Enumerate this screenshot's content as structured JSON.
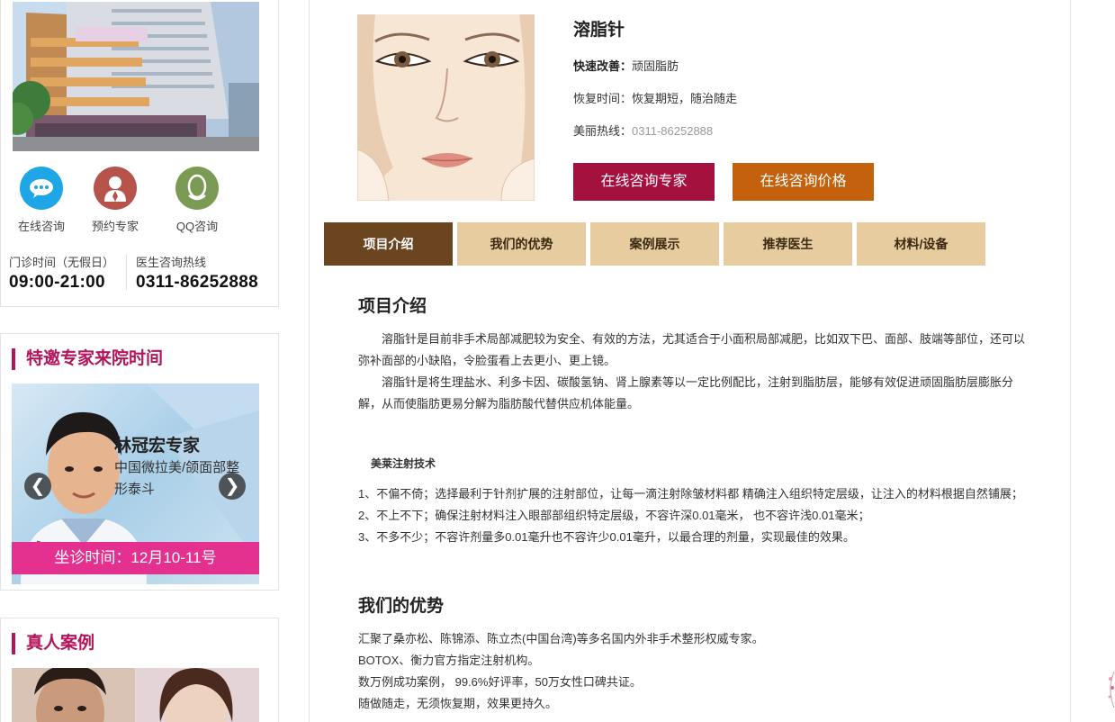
{
  "sidebar": {
    "quick_links": [
      {
        "label": "在线咨询",
        "icon": "chat-bubble-icon",
        "color": "#1ea6e6"
      },
      {
        "label": "预约专家",
        "icon": "doctor-icon",
        "color": "#b6534b"
      },
      {
        "label": "QQ咨询",
        "icon": "qq-penguin-icon",
        "color": "#7b9b55"
      }
    ],
    "hours_label": "门诊时间（无假日）",
    "hours_value": "09:00-21:00",
    "hotline_label": "医生咨询热线",
    "hotline_value": "0311-86252888",
    "expert_section": {
      "title": "特邀专家来院时间",
      "name": "林冠宏专家",
      "desc": "中国微拉美/颌面部整形泰斗",
      "prev": "❮",
      "next": "❯",
      "visit_time": "坐诊时间：12月10-11号"
    },
    "cases_section": {
      "title": "真人案例"
    }
  },
  "product": {
    "title": "溶脂针",
    "quick_label": "快速改善：",
    "quick_value": "顽固脂肪",
    "recovery": "恢复时间：恢复期短，随治随走",
    "hotline_label": "美丽热线：",
    "hotline_value": "0311-86252888",
    "btn_expert": "在线咨询专家",
    "btn_price": "在线咨询价格"
  },
  "tabs": [
    {
      "label": "项目介绍",
      "active": true
    },
    {
      "label": "我们的优势",
      "active": false
    },
    {
      "label": "案例展示",
      "active": false
    },
    {
      "label": "推荐医生",
      "active": false
    },
    {
      "label": "材料/设备",
      "active": false
    }
  ],
  "intro": {
    "heading": "项目介绍",
    "p1": "溶脂针是目前非手术局部减肥较为安全、有效的方法，尤其适合于小面积局部减肥，比如双下巴、面部、肢端等部位，还可以弥补面部的小缺陷，令脸蛋看上去更小、更上镜。",
    "p2": "溶脂针是将生理盐水、利多卡因、碳酸氢钠、肾上腺素等以一定比例配比，注射到脂肪层，能够有效促进顽固脂肪层膨胀分解，从而使脂肪更易分解为脂肪酸代替供应机体能量。"
  },
  "technique": {
    "heading": "美莱注射技术",
    "items": [
      "1、不偏不倚；选择最利于针剂扩展的注射部位，让每一滴注射除皱材料都 精确注入组织特定层级，让注入的材料根据自然铺展；",
      "2、不上不下；确保注射材料注入眼部部组织特定层级，不容许深0.01毫米， 也不容许浅0.01毫米；",
      "3、不多不少；不容许剂量多0.01毫升也不容许少0.01毫升，以最合理的剂量，实现最佳的效果。"
    ]
  },
  "advantages": {
    "heading": "我们的优势",
    "items": [
      "汇聚了桑亦松、陈锦添、陈立杰(中国台湾)等多名国内外非手术整形权威专家。",
      "BOTOX、衡力官方指定注射机构。",
      "数万例成功案例， 99.6%好评率，50万女性口碑共证。",
      "随做随走，无须恢复期，效果更持久。"
    ]
  },
  "colors": {
    "accent": "#b3155a",
    "tab_active": "#6b4520",
    "tab_inactive": "#e6cc9f",
    "btn_expert": "#a5113e",
    "btn_price": "#c3610c",
    "visit_bar": "#e4318f"
  }
}
